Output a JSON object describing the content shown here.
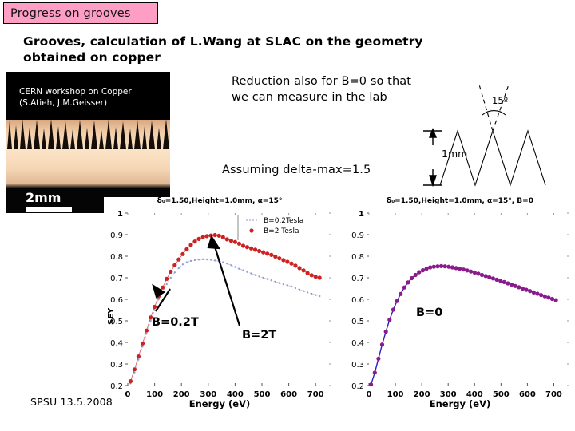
{
  "slide": {
    "banner_title": "Progress on grooves",
    "subtitle": "Grooves, calculation of L.Wang at SLAC on the geometry obtained on copper",
    "footer": "SPSU 13.5.2008"
  },
  "photo": {
    "caption": "CERN workshop on Copper (S.Atieh, J.M.Geisser)",
    "scale_label": "2mm"
  },
  "notes": {
    "reduction": "Reduction also for B=0 so that we can measure in the lab",
    "assuming": "Assuming delta-max=1.5"
  },
  "geometry": {
    "angle_label": "15º",
    "height_label": "1mm"
  },
  "annotations": {
    "b02": "B=0.2T",
    "b2": "B=2T",
    "b0": "B=0"
  },
  "colors": {
    "banner_bg": "#ff9ec4",
    "series_b2": "#cc2222",
    "series_b02": "#8f9ed6",
    "series_b0_line": "#2a1ec8",
    "series_b0_marker": "#8b1a8b"
  },
  "chart_data": [
    {
      "type": "scatter",
      "id": "left",
      "title": "δ₀=1.50,Height=1.0mm, α=15°",
      "xlabel": "Energy (eV)",
      "ylabel": "SEY",
      "xlim": [
        0,
        750
      ],
      "ylim": [
        0.2,
        1.0
      ],
      "xticks": [
        0,
        100,
        200,
        300,
        400,
        500,
        600,
        700
      ],
      "yticks": [
        0.2,
        0.3,
        0.4,
        0.5,
        0.6,
        0.7,
        0.8,
        0.9,
        1
      ],
      "grid": false,
      "legend_position": "top-right",
      "series": [
        {
          "name": "B=0.2Tesla",
          "color": "#8f9ed6",
          "x": [
            10,
            25,
            40,
            55,
            70,
            85,
            100,
            115,
            130,
            145,
            160,
            175,
            190,
            205,
            220,
            235,
            250,
            265,
            280,
            295,
            310,
            325,
            340,
            355,
            370,
            385,
            400,
            415,
            430,
            445,
            460,
            475,
            490,
            505,
            520,
            535,
            550,
            565,
            580,
            595,
            610,
            625,
            640,
            655,
            670,
            685,
            700,
            715
          ],
          "y": [
            0.21,
            0.26,
            0.32,
            0.38,
            0.44,
            0.5,
            0.55,
            0.6,
            0.635,
            0.67,
            0.7,
            0.725,
            0.745,
            0.762,
            0.772,
            0.778,
            0.782,
            0.784,
            0.786,
            0.785,
            0.783,
            0.78,
            0.777,
            0.772,
            0.766,
            0.758,
            0.75,
            0.742,
            0.735,
            0.727,
            0.72,
            0.713,
            0.706,
            0.7,
            0.694,
            0.688,
            0.682,
            0.676,
            0.67,
            0.665,
            0.66,
            0.652,
            0.645,
            0.638,
            0.632,
            0.626,
            0.62,
            0.615
          ]
        },
        {
          "name": "B=2 Tesla",
          "color": "#cc2222",
          "x": [
            10,
            25,
            40,
            55,
            70,
            85,
            100,
            115,
            130,
            145,
            160,
            175,
            190,
            205,
            220,
            235,
            250,
            265,
            280,
            295,
            310,
            325,
            340,
            355,
            370,
            385,
            400,
            415,
            430,
            445,
            460,
            475,
            490,
            505,
            520,
            535,
            550,
            565,
            580,
            595,
            610,
            625,
            640,
            655,
            670,
            685,
            700,
            715
          ],
          "y": [
            0.22,
            0.275,
            0.335,
            0.395,
            0.455,
            0.515,
            0.565,
            0.615,
            0.655,
            0.695,
            0.728,
            0.758,
            0.785,
            0.81,
            0.832,
            0.852,
            0.868,
            0.88,
            0.888,
            0.893,
            0.896,
            0.898,
            0.895,
            0.888,
            0.878,
            0.872,
            0.866,
            0.858,
            0.848,
            0.842,
            0.836,
            0.83,
            0.824,
            0.818,
            0.812,
            0.806,
            0.798,
            0.79,
            0.782,
            0.774,
            0.766,
            0.756,
            0.745,
            0.734,
            0.722,
            0.712,
            0.705,
            0.7
          ]
        }
      ]
    },
    {
      "type": "scatter",
      "id": "right",
      "title": "δ₀=1.50,Height=1.0mm, α=15°, B=0",
      "xlabel": "Energy (eV)",
      "ylabel": "",
      "xlim": [
        0,
        750
      ],
      "ylim": [
        0.2,
        1.0
      ],
      "xticks": [
        0,
        100,
        200,
        300,
        400,
        500,
        600,
        700
      ],
      "yticks": [
        0.2,
        0.3,
        0.4,
        0.5,
        0.6,
        0.7,
        0.8,
        0.9,
        1
      ],
      "grid": false,
      "legend_position": "none",
      "series": [
        {
          "name": "B=0",
          "color": "#8b1a8b",
          "x": [
            8,
            22,
            36,
            50,
            64,
            78,
            92,
            106,
            120,
            134,
            148,
            162,
            176,
            190,
            204,
            218,
            232,
            246,
            260,
            274,
            288,
            302,
            316,
            330,
            344,
            358,
            372,
            386,
            400,
            414,
            428,
            442,
            456,
            470,
            484,
            498,
            512,
            526,
            540,
            554,
            568,
            582,
            596,
            610,
            624,
            638,
            652,
            666,
            680,
            694,
            708
          ],
          "y": [
            0.205,
            0.26,
            0.325,
            0.39,
            0.45,
            0.505,
            0.552,
            0.592,
            0.625,
            0.655,
            0.678,
            0.698,
            0.713,
            0.726,
            0.735,
            0.742,
            0.748,
            0.751,
            0.753,
            0.754,
            0.753,
            0.751,
            0.748,
            0.745,
            0.742,
            0.738,
            0.734,
            0.729,
            0.724,
            0.719,
            0.713,
            0.708,
            0.702,
            0.697,
            0.691,
            0.686,
            0.68,
            0.674,
            0.668,
            0.662,
            0.656,
            0.65,
            0.644,
            0.638,
            0.632,
            0.626,
            0.62,
            0.614,
            0.608,
            0.602,
            0.596
          ]
        }
      ]
    }
  ]
}
